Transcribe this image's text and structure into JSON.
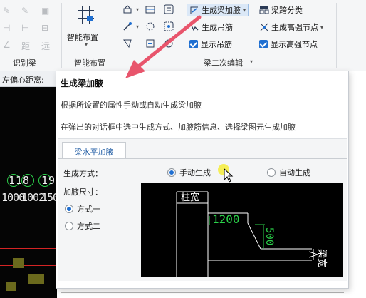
{
  "ribbon": {
    "groups": {
      "identify_beam": "识别梁",
      "smart_layout": "智能布置",
      "beam_secondary_edit": "梁二次编辑"
    },
    "buttons": {
      "smart_layout": "智能布置",
      "generate_haunch": "生成梁加腋",
      "beam_span_classify": "梁跨分类",
      "generate_hanger": "生成吊筋",
      "generate_high_strength_node": "生成高强节点",
      "show_hanger": "显示吊筋",
      "show_high_strength_node": "显示高强节点"
    }
  },
  "workspace": {
    "offset_label": "左偏心距离:",
    "cad_numbers": [
      "1",
      "1",
      "8",
      "1",
      "9",
      "1000",
      "1002",
      "150"
    ]
  },
  "popup": {
    "title": "生成梁加腋",
    "desc1": "根据所设置的属性手动或自动生成梁加腋",
    "desc2": "在弹出的对话框中选中生成方式、加腋筋信息、选择梁图元生成加腋",
    "tab": "梁水平加腋",
    "gen_mode_label": "生成方式：",
    "gen_mode_options": [
      "手动生成",
      "自动生成"
    ],
    "gen_mode_selected": "手动生成",
    "size_label": "加腋尺寸：",
    "size_options": [
      "方式一",
      "方式二"
    ],
    "size_selected": "方式一",
    "preview": {
      "column_width": "柱宽",
      "dim_horizontal": "1200",
      "dim_vertical": "500",
      "beam_width": "梁宽"
    }
  },
  "colors": {
    "accent": "#1f6fd1",
    "arrow": "#e8556c",
    "cad_green": "#2bd14a",
    "cad_bg": "#000000"
  }
}
